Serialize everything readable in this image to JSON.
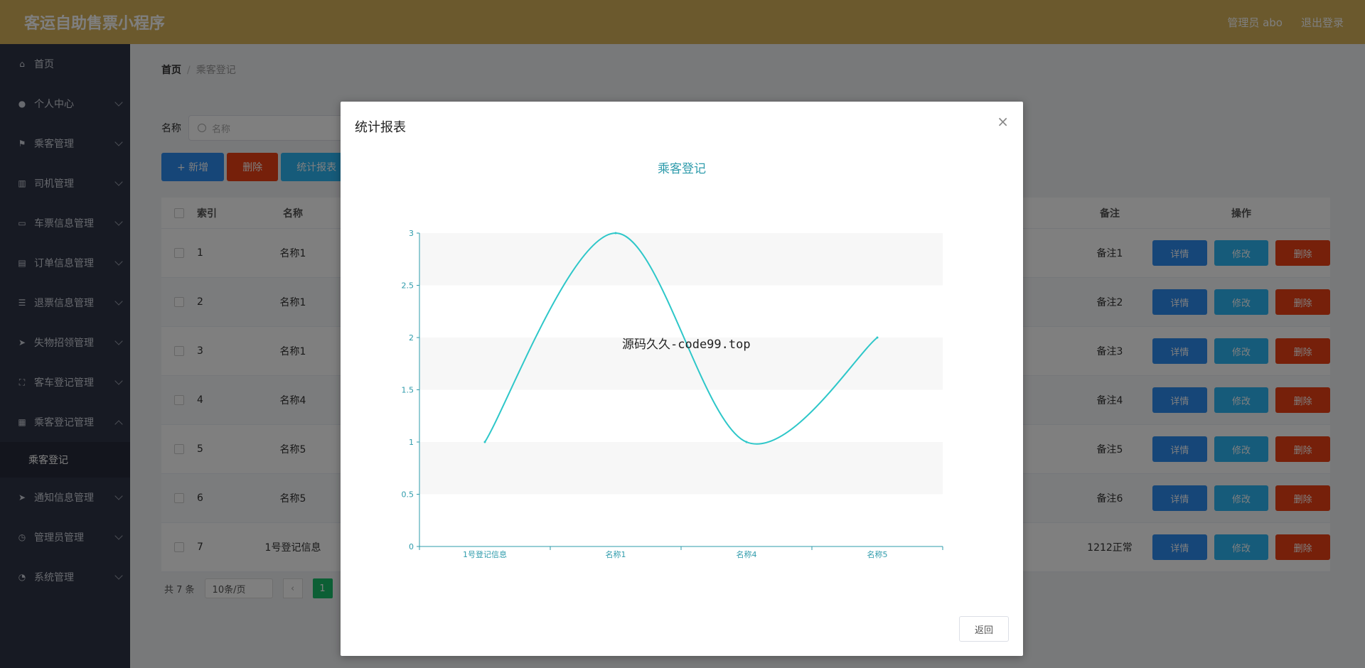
{
  "header": {
    "app_title": "客运自助售票小程序",
    "user": "管理员 abo",
    "logout": "退出登录"
  },
  "sidebar": {
    "items": [
      {
        "label": "首页",
        "icon": "home-icon"
      },
      {
        "label": "个人中心",
        "icon": "user-icon"
      },
      {
        "label": "乘客管理",
        "icon": "flag-icon"
      },
      {
        "label": "司机管理",
        "icon": "bar-icon"
      },
      {
        "label": "车票信息管理",
        "icon": "chat-icon"
      },
      {
        "label": "订单信息管理",
        "icon": "doc-icon"
      },
      {
        "label": "退票信息管理",
        "icon": "list-icon"
      },
      {
        "label": "失物招领管理",
        "icon": "send-icon"
      },
      {
        "label": "客车登记管理",
        "icon": "scan-icon"
      },
      {
        "label": "乘客登记管理",
        "icon": "grid-icon"
      },
      {
        "label": "通知信息管理",
        "icon": "send-icon"
      },
      {
        "label": "管理员管理",
        "icon": "clock-icon"
      },
      {
        "label": "系统管理",
        "icon": "gauge-icon"
      }
    ],
    "sub_item": "乘客登记"
  },
  "breadcrumb": {
    "home": "首页",
    "sep": "/",
    "current": "乘客登记"
  },
  "search": {
    "label": "名称",
    "placeholder": "名称"
  },
  "toolbar": {
    "add": "+ 新增",
    "delete": "删除",
    "stats": "统计报表"
  },
  "table": {
    "headers": {
      "index": "索引",
      "name": "名称",
      "note": "备注",
      "ops": "操作"
    },
    "rows": [
      {
        "index": "1",
        "name": "名称1",
        "note": "备注1"
      },
      {
        "index": "2",
        "name": "名称1",
        "note": "备注2"
      },
      {
        "index": "3",
        "name": "名称1",
        "note": "备注3"
      },
      {
        "index": "4",
        "name": "名称4",
        "note": "备注4"
      },
      {
        "index": "5",
        "name": "名称5",
        "note": "备注5"
      },
      {
        "index": "6",
        "name": "名称5",
        "note": "备注6"
      },
      {
        "index": "7",
        "name": "1号登记信息",
        "note": "1212正常"
      }
    ],
    "ops": {
      "detail": "详情",
      "edit": "修改",
      "delete": "删除"
    }
  },
  "pager": {
    "total": "共 7 条",
    "size": "10条/页",
    "page": "1"
  },
  "modal": {
    "title": "统计报表",
    "close": "×",
    "back": "返回"
  },
  "watermark": "源码久久-code99.top",
  "chart_data": {
    "type": "line",
    "title": "乘客登记",
    "categories": [
      "1号登记信息",
      "名称1",
      "名称4",
      "名称5"
    ],
    "series": [
      {
        "values": [
          1,
          3,
          1,
          2
        ]
      }
    ],
    "ylim": [
      0,
      3
    ],
    "yticks": [
      "0",
      "0.5",
      "1",
      "1.5",
      "2",
      "2.5",
      "3"
    ],
    "smooth": true,
    "colors": {
      "line": "#2ec7c9",
      "axis": "#2e9bab"
    }
  }
}
